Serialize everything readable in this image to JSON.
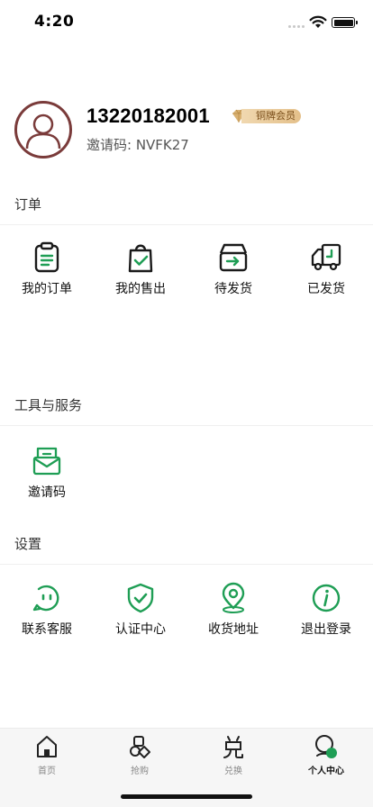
{
  "status_bar": {
    "time": "4:20"
  },
  "profile": {
    "phone": "13220182001",
    "member_level": "铜牌会员",
    "invite_code_line": "邀请码: NVFK27"
  },
  "sections": {
    "orders": {
      "title": "订单",
      "items": [
        {
          "label": "我的订单",
          "icon": "clipboard-icon"
        },
        {
          "label": "我的售出",
          "icon": "shopping-bag-check-icon"
        },
        {
          "label": "待发货",
          "icon": "box-arrow-icon"
        },
        {
          "label": "已发货",
          "icon": "delivery-truck-icon"
        }
      ]
    },
    "tools": {
      "title": "工具与服务",
      "items": [
        {
          "label": "邀请码",
          "icon": "envelope-icon"
        }
      ]
    },
    "settings": {
      "title": "设置",
      "items": [
        {
          "label": "联系客服",
          "icon": "chat-face-icon"
        },
        {
          "label": "认证中心",
          "icon": "shield-check-icon"
        },
        {
          "label": "收货地址",
          "icon": "location-pin-icon"
        },
        {
          "label": "退出登录",
          "icon": "info-circle-icon"
        }
      ]
    }
  },
  "tab_bar": {
    "active": "个人中心",
    "tabs": [
      {
        "label": "首页",
        "icon": "home-icon"
      },
      {
        "label": "抢购",
        "icon": "flash-buy-icon"
      },
      {
        "label": "兑换",
        "icon": "exchange-icon"
      },
      {
        "label": "个人中心",
        "icon": "profile-icon"
      }
    ]
  },
  "colors": {
    "accent_green": "#1f9e55",
    "icon_dark": "#1a1a1a",
    "avatar_border": "#7a3b3a",
    "badge_gold": "#e4c08a"
  }
}
